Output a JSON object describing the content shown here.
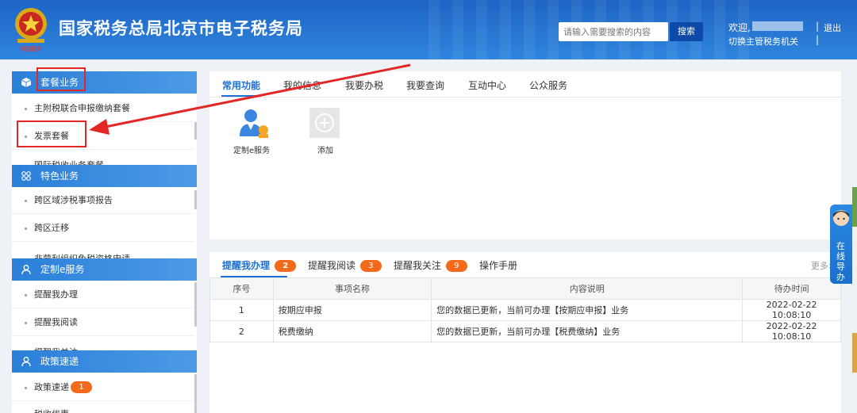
{
  "header": {
    "title": "国家税务总局北京市电子税务局",
    "emblem_caption": "中国税务",
    "search_placeholder": "请输入需要搜索的内容",
    "search_label": "搜索",
    "welcome": "欢迎,",
    "switch_tax_office": "切换主管税务机关",
    "logout": "退出",
    "divider": "|"
  },
  "sidebar": {
    "sections": [
      {
        "title": "套餐业务",
        "icon": "cube-icon",
        "items": [
          "主附税联合申报缴纳套餐",
          "发票套餐",
          "国际税收业务套餐"
        ]
      },
      {
        "title": "特色业务",
        "icon": "grid-icon",
        "items": [
          "跨区域涉税事项报告",
          "跨区迁移",
          "非营利组织免税资格申请"
        ]
      },
      {
        "title": "定制e服务",
        "icon": "user-icon",
        "items": [
          "提醒我办理",
          "提醒我阅读",
          "提醒我关注"
        ]
      },
      {
        "title": "政策速递",
        "icon": "user-icon",
        "items": [
          "政策速递",
          "税收优惠"
        ],
        "badge": "1"
      }
    ]
  },
  "panel_top": {
    "tabs": [
      "常用功能",
      "我的信息",
      "我要办税",
      "我要查询",
      "互动中心",
      "公众服务"
    ],
    "active_tab": 0,
    "services": [
      {
        "label": "定制e服务",
        "icon": "person-service-icon"
      },
      {
        "label": "添加",
        "icon": "plus-icon"
      }
    ]
  },
  "panel_bottom": {
    "tabs": [
      {
        "label": "提醒我办理",
        "count": "2"
      },
      {
        "label": "提醒我阅读",
        "count": "3"
      },
      {
        "label": "提醒我关注",
        "count": "9"
      },
      {
        "label": "操作手册",
        "count": ""
      }
    ],
    "more": "更多>",
    "columns": [
      "序号",
      "事项名称",
      "内容说明",
      "待办时间"
    ],
    "rows": [
      [
        "1",
        "按期应申报",
        "您的数据已更新，当前可办理【按期应申报】业务",
        "2022-02-22 10:08:10"
      ],
      [
        "2",
        "税费缴纳",
        "您的数据已更新，当前可办理【税费缴纳】业务",
        "2022-02-22 10:08:10"
      ]
    ]
  },
  "float_helper": {
    "label": "在线导办"
  },
  "colors": {
    "brand_blue": "#1e70d5",
    "badge_orange": "#f36a1b",
    "annotation_red": "#e32727"
  }
}
